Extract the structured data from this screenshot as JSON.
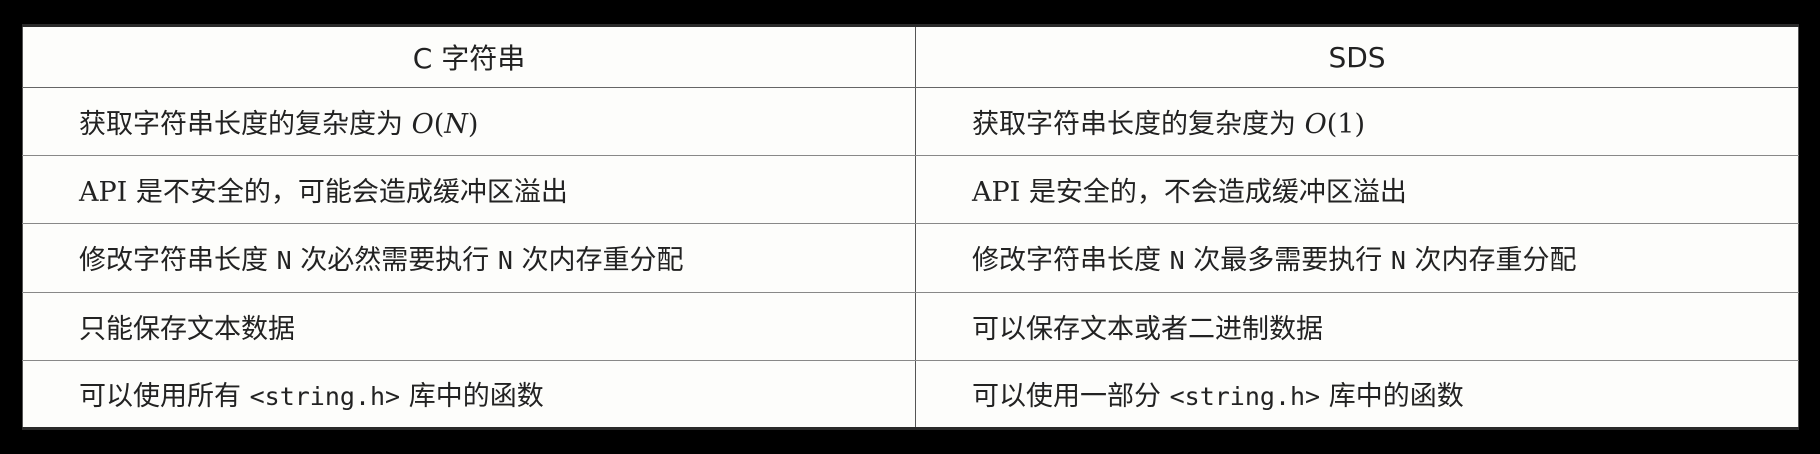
{
  "table": {
    "headers": [
      "C 字符串",
      "SDS"
    ],
    "rows": [
      {
        "left": {
          "prefix": "获取字符串长度的复杂度为 ",
          "math_o": "O",
          "open": "(",
          "arg": "N",
          "close": ")"
        },
        "right": {
          "prefix": "获取字符串长度的复杂度为 ",
          "math_o": "O",
          "open": "(",
          "arg": "1",
          "close": ")"
        }
      },
      {
        "left": {
          "api": "API",
          "text": " 是不安全的，可能会造成缓冲区溢出"
        },
        "right": {
          "api": "API",
          "text": " 是安全的，不会造成缓冲区溢出"
        }
      },
      {
        "left": {
          "p1": "修改字符串长度 ",
          "n1": "N",
          "p2": " 次必然需要执行 ",
          "n2": "N",
          "p3": " 次内存重分配"
        },
        "right": {
          "p1": "修改字符串长度 ",
          "n1": "N",
          "p2": " 次最多需要执行 ",
          "n2": "N",
          "p3": " 次内存重分配"
        }
      },
      {
        "left": {
          "text": "只能保存文本数据"
        },
        "right": {
          "text": "可以保存文本或者二进制数据"
        }
      },
      {
        "left": {
          "p1": "可以使用所有 ",
          "code": "<string.h>",
          "p2": " 库中的函数"
        },
        "right": {
          "p1": "可以使用一部分 ",
          "code": "<string.h>",
          "p2": " 库中的函数"
        }
      }
    ]
  }
}
